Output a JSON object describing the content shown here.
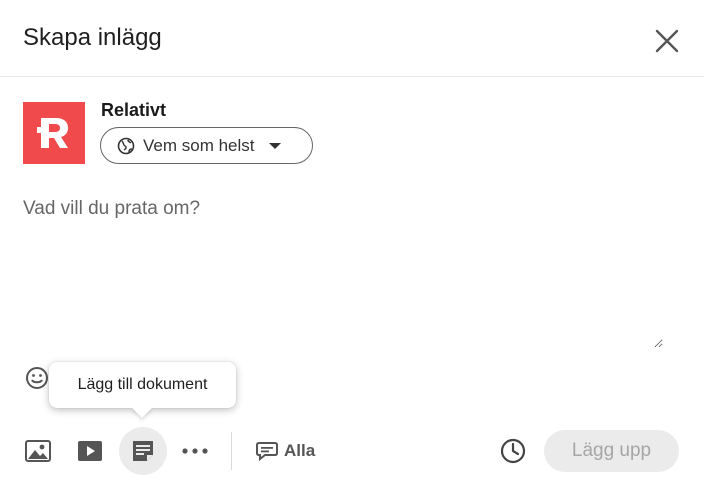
{
  "dialog": {
    "title": "Skapa inlägg"
  },
  "author": {
    "name": "Relativt",
    "avatar_color": "#f04a4d"
  },
  "visibility": {
    "label": "Vem som helst"
  },
  "editor": {
    "placeholder": "Vad vill du prata om?"
  },
  "tooltip": {
    "text": "Lägg till dokument"
  },
  "toolbar": {
    "comment_setting": "Alla",
    "post_label": "Lägg upp"
  }
}
